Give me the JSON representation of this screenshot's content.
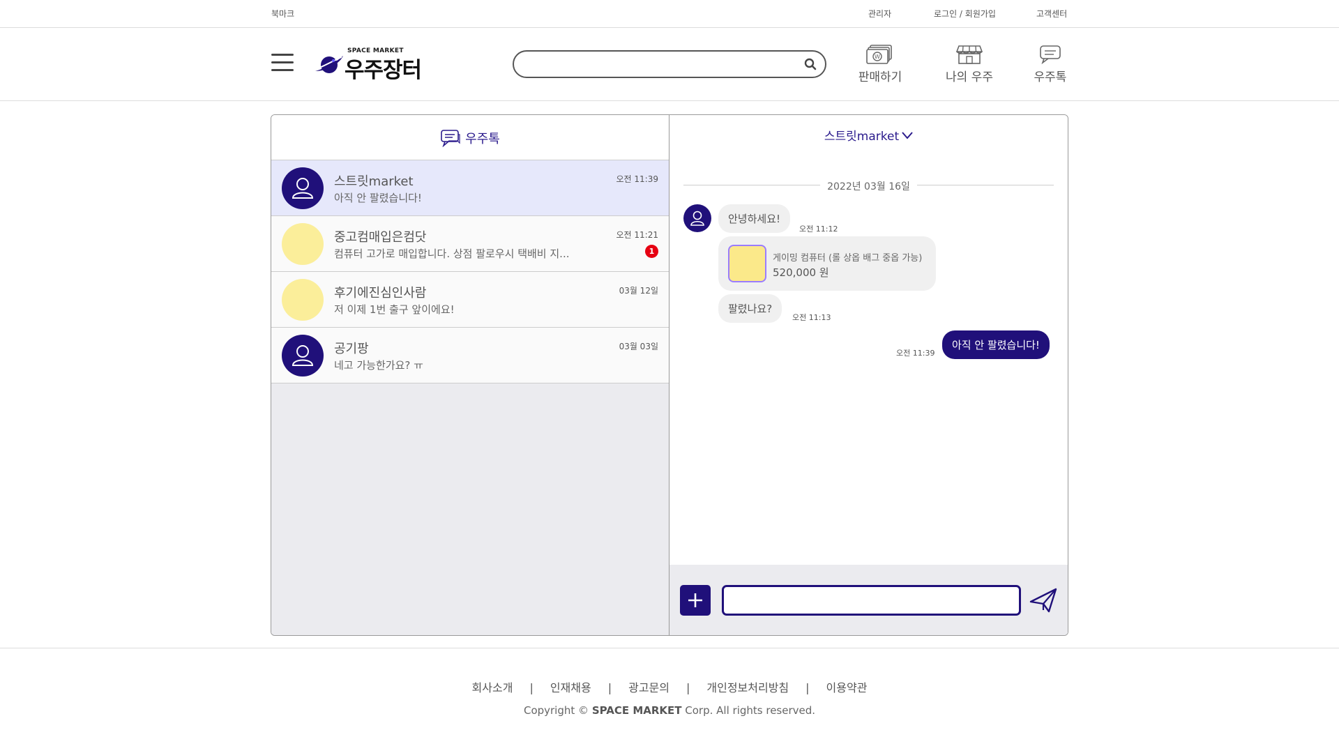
{
  "utilbar": {
    "bookmark": "북마크",
    "admin": "관리자",
    "login": "로그인 / 회원가입",
    "support": "고객센터"
  },
  "header": {
    "logo_sub": "SPACE MARKET",
    "logo_main": "우주장터",
    "search_placeholder": "",
    "nav": [
      {
        "label": "판매하기",
        "icon": "sell-money-icon"
      },
      {
        "label": "나의 우주",
        "icon": "store-icon"
      },
      {
        "label": "우주톡",
        "icon": "chat-icon"
      }
    ]
  },
  "chat_list": {
    "title": "우주톡",
    "items": [
      {
        "name": "스트릿market",
        "message": "아직 안 팔렸습니다!",
        "time": "오전 11:39",
        "avatar": "user-avatar-icon",
        "active": true
      },
      {
        "name": "중고컴매입은컴닷",
        "message": "컴퓨터 고가로 매입합니다. 상점 팔로우시 택배비 지...",
        "time": "오전 11:21",
        "badge": "1",
        "avatar": "yellow-avatar"
      },
      {
        "name": "후기에진심인사람",
        "message": "저 이제 1번 출구 앞이에요!",
        "time": "03월 12일",
        "avatar": "yellow-avatar"
      },
      {
        "name": "공기팡",
        "message": "네고 가능한가요? ㅠ",
        "time": "03월 03일",
        "avatar": "user-avatar-icon"
      }
    ]
  },
  "chat_room": {
    "title": "스트릿market",
    "date": "2022년 03월 16일",
    "messages": [
      {
        "text": "안녕하세요!",
        "time": "오전 11:12"
      },
      {
        "product_name": "게이밍 컴퓨터 (롤 상옵 배그 중옵 가능)",
        "product_price": "520,000 원"
      },
      {
        "text": "팔렸나요?",
        "time": "오전 11:13"
      },
      {
        "text": "아직 안 팔렸습니다!",
        "time": "오전 11:39"
      }
    ],
    "input_value": ""
  },
  "footer": {
    "links": [
      "회사소개",
      "인재채용",
      "광고문의",
      "개인정보처리방침",
      "이용약관"
    ],
    "separator": "|",
    "copyright_prefix": "Copyright © ",
    "copyright_brand": "SPACE MARKET",
    "copyright_suffix": " Corp. All rights reserved."
  },
  "colors": {
    "brand": "#20107a",
    "badge": "#e60012",
    "avatar_yellow": "#fbee9a",
    "active_row": "#e6e8fb"
  }
}
